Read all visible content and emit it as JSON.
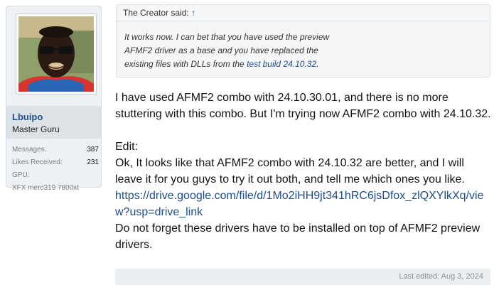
{
  "sidebar": {
    "username": "Lbuipo",
    "user_title": "Master Guru",
    "stats": [
      {
        "key": "Messages:",
        "value": "387"
      },
      {
        "key": "Likes Received:",
        "value": "231"
      }
    ],
    "gpu_label": "GPU:",
    "gpu_value": "XFX merc319 7800xt"
  },
  "quote": {
    "author_prefix": "The Creator said:",
    "arrow": "↑",
    "line1": "It works now. I can bet that you have used the preview",
    "line2": "AFMF2 driver as a base and you have replaced the",
    "line3_pre": "existing files with DLLs from the ",
    "link": "test build 24.10.32",
    "line3_post": "."
  },
  "post": {
    "p1": "I have used AFMF2 combo with 24.10.30.01, and there is no more stuttering with this combo. But I'm trying now AFMF2 combo with 24.10.32.",
    "edit_label": "Edit:",
    "p2": "Ok, It looks like that AFMF2 combo with 24.10.32 are better, and I will leave it for you guys to try it out both, and tell me which ones you like.",
    "link": "https://drive.google.com/file/d/1Mo2iHH9jt341hRC6jsDfox_zlQXYlkXq/view?usp=drive_link",
    "p3": "Do not forget these drivers have to be installed on top of AFMF2 preview drivers."
  },
  "footer": {
    "last_edited": "Last edited: Aug 3, 2024"
  }
}
